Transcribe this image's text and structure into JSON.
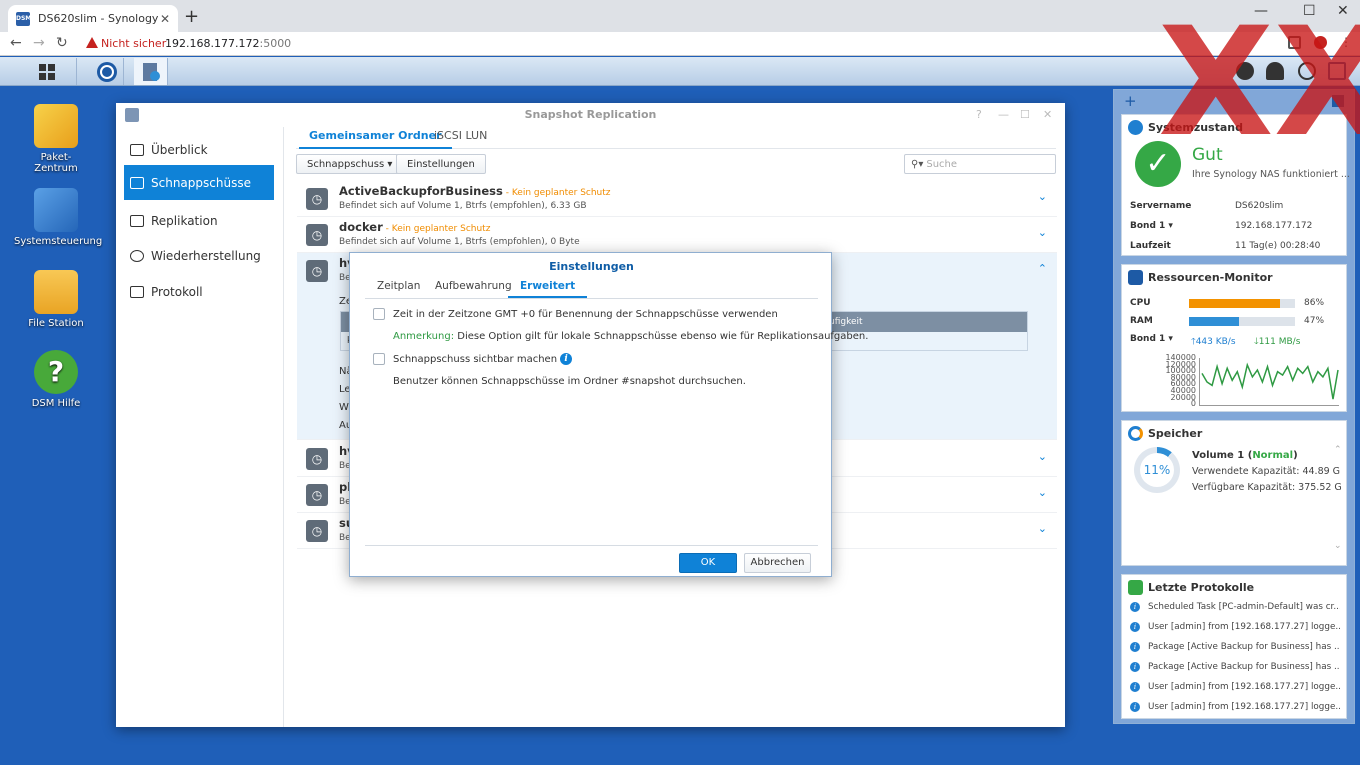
{
  "browser": {
    "tab_title": "DS620slim - Synology NAS",
    "favicon_text": "DSM",
    "tab_close": "✕",
    "new_tab": "+",
    "min": "—",
    "max": "☐",
    "close": "✕",
    "back": "←",
    "forward": "→",
    "reload": "↻",
    "security_label": "Nicht sicher",
    "url_host": "192.168.177.172",
    "url_port": ":5000"
  },
  "watermark": "XX",
  "desktop": {
    "icons": [
      {
        "label": "Paket-\nZentrum",
        "color": "#f2c230"
      },
      {
        "label": "Systemsteuerung",
        "color": "#3d86d4"
      },
      {
        "label": "File Station",
        "color": "#f4b636"
      },
      {
        "label": "DSM Hilfe",
        "color": "#48a93a",
        "glyph": "?"
      }
    ]
  },
  "window": {
    "title": "Snapshot Replication",
    "sidebar": [
      {
        "label": "Überblick"
      },
      {
        "label": "Schnappschüsse"
      },
      {
        "label": "Replikation"
      },
      {
        "label": "Wiederherstellung"
      },
      {
        "label": "Protokoll"
      }
    ],
    "tabs": [
      "Gemeinsamer Ordner",
      "iSCSI LUN"
    ],
    "toolbar": {
      "snapshot_btn": "Schnappschuss ▾",
      "settings_btn": "Einstellungen",
      "search_placeholder": "Suche",
      "search_glyph": "⚲▾"
    },
    "rows": [
      {
        "name": "ActiveBackupforBusiness",
        "status": " - Kein geplanter Schutz",
        "sub": "Befindet sich auf Volume 1, Btrfs (empfohlen), 6.33 GB"
      },
      {
        "name": "docker",
        "status": " - Kein geplanter Schutz",
        "sub": "Befindet sich auf Volume 1, Btrfs (empfohlen), 0 Byte"
      },
      {
        "name": "hv",
        "sub": "Be"
      },
      {
        "name": "hv",
        "sub": "Be"
      },
      {
        "name": "ph",
        "sub": "Be"
      },
      {
        "name": "su",
        "sub": "Be"
      }
    ],
    "expanded": {
      "zeit": "Ze",
      "col_hdr": "ufigkeit",
      "cell": "k",
      "lines": [
        "Nä",
        "Le",
        "W",
        "Au"
      ]
    },
    "chev_down": "⌄",
    "chev_up": "⌃"
  },
  "dialog": {
    "title": "Einstellungen",
    "tabs": [
      "Zeitplan",
      "Aufbewahrung",
      "Erweitert"
    ],
    "option1": "Zeit in der Zeitzone GMT +0 für Benennung der Schnappschüsse verwenden",
    "note_label": "Anmerkung:",
    "note_text": " Diese Option gilt für lokale Schnappschüsse ebenso wie für Replikationsaufgaben.",
    "option2": "Schnappschuss sichtbar machen",
    "option2_desc": "Benutzer können Schnappschüsse im Ordner #snapshot durchsuchen.",
    "ok": "OK",
    "cancel": "Abbrechen"
  },
  "widgets": {
    "add": "+",
    "system": {
      "title": "Systemzustand",
      "status": "Gut",
      "status_sub": "Ihre Synology NAS funktioniert ...",
      "servername_key": "Servername",
      "servername_val": "DS620slim",
      "bond_key": "Bond 1 ▾",
      "bond_val": "192.168.177.172",
      "uptime_key": "Laufzeit",
      "uptime_val": "11 Tag(e) 00:28:40"
    },
    "resources": {
      "title": "Ressourcen-Monitor",
      "cpu_label": "CPU",
      "cpu_pct": "86%",
      "cpu_value": 86,
      "cpu_color": "#f39200",
      "ram_label": "RAM",
      "ram_pct": "47%",
      "ram_value": 47,
      "ram_color": "#2f8fd6",
      "bond_label": "Bond 1 ▾",
      "up": "443 KB/s",
      "down": "111 MB/s",
      "y_ticks": [
        "140000",
        "120000",
        "100000",
        "80000",
        "60000",
        "40000",
        "20000",
        "0"
      ],
      "series": [
        95,
        70,
        60,
        115,
        65,
        110,
        75,
        100,
        55,
        120,
        85,
        105,
        70,
        115,
        60,
        100,
        90,
        115,
        75,
        110,
        95,
        115,
        70,
        100,
        85,
        110,
        20,
        105
      ]
    },
    "storage": {
      "title": "Speicher",
      "percent": "11%",
      "volume": "Volume 1 (",
      "volume_status": "Normal",
      "volume_close": ")",
      "used": "Verwendete Kapazität: 44.89 G",
      "free": "Verfügbare Kapazität: 375.52 G"
    },
    "logs": {
      "title": "Letzte Protokolle",
      "items": [
        "Scheduled Task [PC-admin-Default] was cr...",
        "User [admin] from [192.168.177.27] logge...",
        "Package [Active Backup for Business] has ...",
        "Package [Active Backup for Business] has ...",
        "User [admin] from [192.168.177.27] logge...",
        "User [admin] from [192.168.177.27] logge..."
      ]
    }
  }
}
